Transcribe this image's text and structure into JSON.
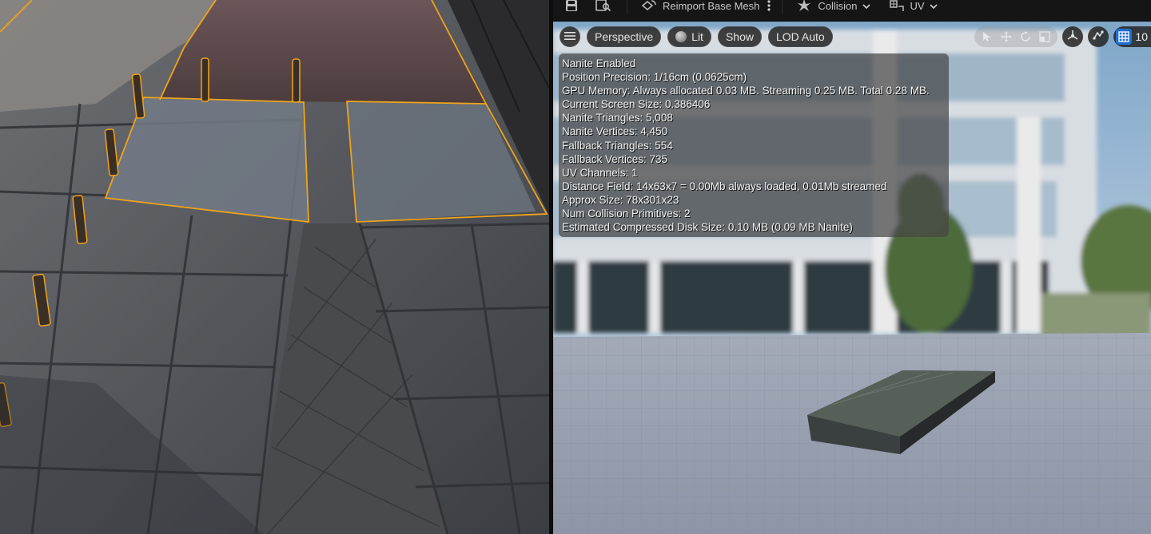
{
  "toolbar": {
    "reimport_label": "Reimport Base Mesh",
    "collision_label": "Collision",
    "uv_label": "UV"
  },
  "viewport_controls": {
    "perspective_label": "Perspective",
    "lit_label": "Lit",
    "show_label": "Show",
    "lod_label": "LOD Auto",
    "grid_snap_value": "10"
  },
  "stats": {
    "lines": [
      "Nanite Enabled",
      "Position Precision: 1/16cm (0.0625cm)",
      "GPU Memory: Always allocated 0.03 MB. Streaming 0.25 MB. Total 0.28 MB.",
      "Current Screen Size: 0.386406",
      "Nanite Triangles: 5,008",
      "Nanite Vertices: 4,450",
      "Fallback Triangles: 554",
      "Fallback Vertices: 735",
      "UV Channels: 1",
      "Distance Field: 14x63x7 = 0.00Mb always loaded, 0.01Mb streamed",
      "Approx Size: 78x301x23",
      "Num Collision Primitives: 2",
      "Estimated Compressed Disk Size: 0.10 MB (0.09 MB Nanite)"
    ]
  },
  "colors": {
    "selection_outline": "#f0a31a",
    "grid_snap_active": "#1f6fd6",
    "toolbar_bg": "#151515"
  },
  "icons": {
    "save": "save-icon",
    "browse": "browse-asset-icon",
    "reimport": "reimport-mesh-icon",
    "collision": "collision-icon",
    "uv": "uv-icon",
    "menu": "hamburger-menu-icon",
    "lit": "lit-sphere-icon",
    "select_tool": "select-tool-icon",
    "translate_tool": "translate-tool-icon",
    "rotate_tool": "rotate-tool-icon",
    "scale_tool": "scale-tool-icon",
    "local_space": "local-space-icon",
    "surface_snap": "surface-snap-icon",
    "grid_snap": "grid-snap-icon"
  }
}
